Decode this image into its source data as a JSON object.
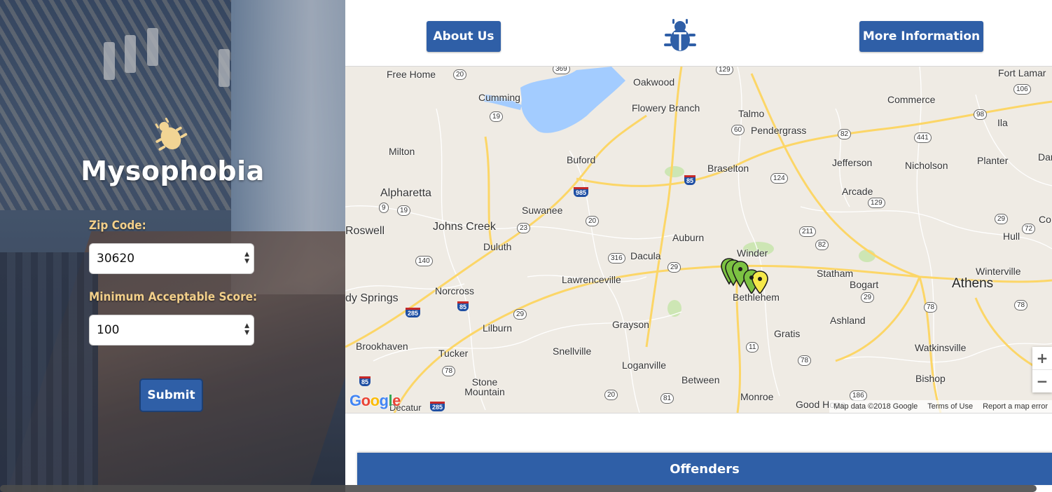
{
  "brand": {
    "title": "Mysophobia",
    "icon": "bug-icon",
    "icon_color": "#f2d494"
  },
  "form": {
    "zip_label": "Zip Code:",
    "zip_value": "30620",
    "score_label": "Minimum Acceptable Score:",
    "score_value": "100",
    "submit_label": "Submit"
  },
  "nav": {
    "about_label": "About Us",
    "more_info_label": "More Information",
    "center_icon": "bug-icon"
  },
  "map": {
    "places": [
      "Free Home",
      "Oakwood",
      "Fort Lamar",
      "Commerce",
      "Ila",
      "Cumming",
      "Flowery Branch",
      "Talmo",
      "Pendergrass",
      "Milton",
      "Buford",
      "Braselton",
      "Jefferson",
      "Nicholson",
      "Planter",
      "Danielsville",
      "Alpharetta",
      "Arcade",
      "Suwanee",
      "Roswell",
      "Johns Creek",
      "Duluth",
      "Auburn",
      "Hull",
      "Winder",
      "Dacula",
      "Statham",
      "Winterville",
      "Athens",
      "Bogart",
      "Norcross",
      "Lawrenceville",
      "Bethlehem",
      "dy Springs",
      "Ashland",
      "Lilburn",
      "Grayson",
      "Gratis",
      "Brookhaven",
      "Tucker",
      "Snellville",
      "Watkinsville",
      "Loganville",
      "Stone Mountain",
      "Between",
      "Bishop",
      "Monroe",
      "Good Hope",
      "Decatur",
      "Co"
    ],
    "shields": [
      "369",
      "129",
      "20",
      "106",
      "98",
      "19",
      "82",
      "441",
      "985",
      "60",
      "124",
      "85",
      "9",
      "19",
      "20",
      "129",
      "23",
      "211",
      "82",
      "29",
      "72",
      "316",
      "140",
      "29",
      "29",
      "78",
      "85",
      "285",
      "29",
      "78",
      "11",
      "78",
      "285",
      "78",
      "85",
      "20",
      "81",
      "186"
    ],
    "attribution": [
      "Map data ©2018 Google",
      "Terms of Use",
      "Report a map error"
    ],
    "google_logo": "Google",
    "zoom_in": "+",
    "zoom_out": "−",
    "water_color": "#a3ccff",
    "road_color": "#fcd667",
    "marker_green": "#7cc242",
    "marker_yellow": "#f5e84a"
  },
  "offenders_label": "Offenders",
  "colors": {
    "primary": "#2f5fa7",
    "label": "#f2cf8a"
  }
}
